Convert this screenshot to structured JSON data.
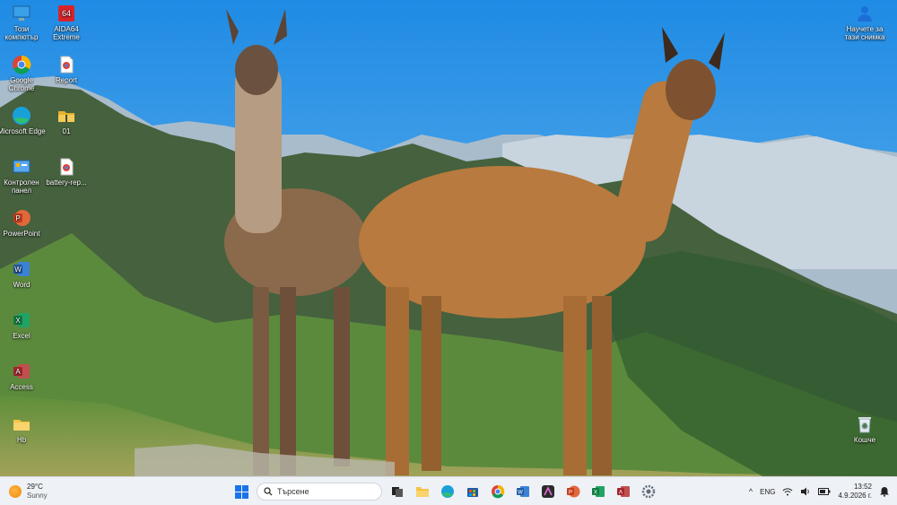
{
  "desktop": {
    "icons_left": [
      {
        "name": "this-pc",
        "label": "Този компютър",
        "icon": "monitor-icon"
      },
      {
        "name": "google-chrome",
        "label": "Google Chrome",
        "icon": "chrome-icon"
      },
      {
        "name": "microsoft-edge",
        "label": "Microsoft Edge",
        "icon": "edge-icon"
      },
      {
        "name": "control-panel",
        "label": "Контролен панел",
        "icon": "control-panel-icon"
      },
      {
        "name": "powerpoint",
        "label": "PowerPoint",
        "icon": "powerpoint-icon"
      },
      {
        "name": "word",
        "label": "Word",
        "icon": "word-icon"
      },
      {
        "name": "excel",
        "label": "Excel",
        "icon": "excel-icon"
      },
      {
        "name": "access",
        "label": "Access",
        "icon": "access-icon"
      },
      {
        "name": "folder-hb",
        "label": "Hb",
        "icon": "folder-icon"
      }
    ],
    "icons_second": [
      {
        "name": "aida64",
        "label": "AIDA64 Extreme",
        "icon": "aida64-icon"
      },
      {
        "name": "report",
        "label": "Report",
        "icon": "chrome-doc-icon"
      },
      {
        "name": "folder-01",
        "label": "01",
        "icon": "folder-zip-icon"
      },
      {
        "name": "battery-report",
        "label": "battery-rep...",
        "icon": "chrome-doc-icon"
      }
    ],
    "icons_right": [
      {
        "name": "learn-about-picture",
        "label": "Научете за тази снимка",
        "icon": "info-person-icon"
      },
      {
        "name": "recycle-bin",
        "label": "Кошче",
        "icon": "recycle-bin-icon"
      }
    ]
  },
  "taskbar": {
    "weather": {
      "temp": "29°C",
      "condition": "Sunny"
    },
    "search_placeholder": "Търсене",
    "pinned": [
      "task-view-icon",
      "file-explorer-icon",
      "edge-icon",
      "store-icon",
      "chrome-icon",
      "word-icon",
      "snip-icon",
      "powerpoint-icon",
      "excel-icon",
      "access-icon",
      "settings-icon"
    ],
    "tray": {
      "language": "ENG",
      "time": "13:52",
      "date": "4.9.2026 г."
    }
  },
  "colors": {
    "accent": "#1a73e8",
    "taskbar_bg": "#eef1f6"
  }
}
